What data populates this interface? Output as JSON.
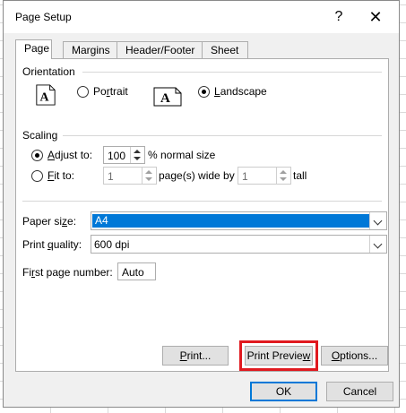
{
  "dialog": {
    "title": "Page Setup",
    "help_glyph": "?",
    "close_glyph": "✕"
  },
  "tabs": [
    {
      "label": "Page",
      "active": true
    },
    {
      "label": "Margins",
      "active": false
    },
    {
      "label": "Header/Footer",
      "active": false
    },
    {
      "label": "Sheet",
      "active": false
    }
  ],
  "orientation": {
    "label": "Orientation",
    "portrait": {
      "label_pre": "Po",
      "label_u": "r",
      "label_post": "trait",
      "checked": false,
      "icon": "portrait-page-icon"
    },
    "landscape": {
      "label_pre": "",
      "label_u": "L",
      "label_post": "andscape",
      "checked": true,
      "icon": "landscape-page-icon"
    },
    "icon_letter": "A"
  },
  "scaling": {
    "label": "Scaling",
    "adjust_to": {
      "label_u": "A",
      "label_post": "djust to:",
      "value": "100",
      "suffix": "% normal size",
      "checked": true
    },
    "fit_to": {
      "label_u": "F",
      "label_post": "it to:",
      "wide_value": "1",
      "wide_suffix": "page(s) wide by",
      "tall_value": "1",
      "tall_suffix": "tall",
      "checked": false
    }
  },
  "paper": {
    "size_label_pre": "Paper si",
    "size_label_u": "z",
    "size_label_post": "e:",
    "size_value": "A4",
    "quality_label_pre": "Print ",
    "quality_label_u": "q",
    "quality_label_post": "uality:",
    "quality_value": "600 dpi",
    "first_page_label_pre": "Fi",
    "first_page_label_u": "r",
    "first_page_label_post": "st page number:",
    "first_page_value": "Auto"
  },
  "buttons": {
    "print_pre": "",
    "print_u": "P",
    "print_post": "rint...",
    "preview_pre": "Print Previe",
    "preview_u": "w",
    "preview_post": "",
    "options_pre": "",
    "options_u": "O",
    "options_post": "ptions...",
    "ok": "OK",
    "cancel": "Cancel"
  },
  "colors": {
    "accent": "#0078d7",
    "highlight_box": "#e0191f"
  }
}
